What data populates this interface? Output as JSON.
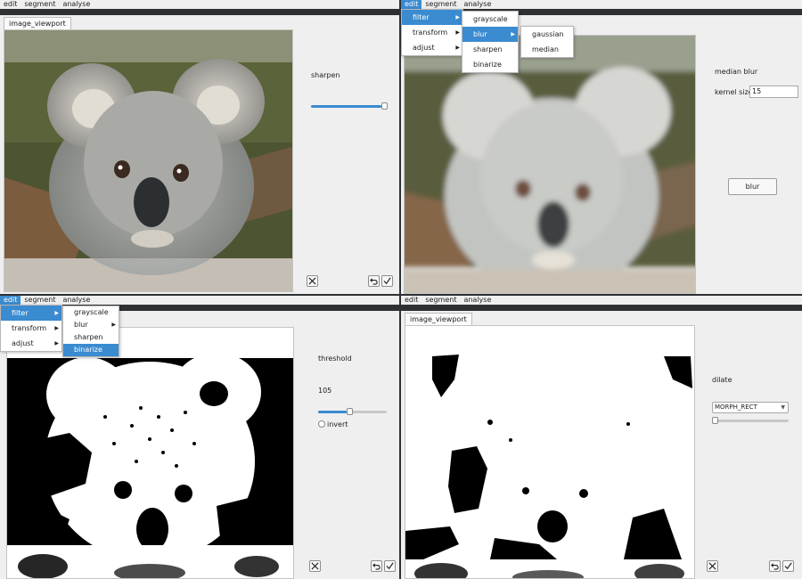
{
  "menu": [
    "edit",
    "segment",
    "analyse"
  ],
  "edit_items": [
    "filter",
    "transform",
    "adjust"
  ],
  "filter_items": [
    "grayscale",
    "blur",
    "sharpen",
    "binarize"
  ],
  "blur_items": [
    "gaussian",
    "median"
  ],
  "viewport_tab": "image_viewport",
  "panel1": {
    "title": "sharpen",
    "slider_value": 0.98
  },
  "panel2": {
    "title": "median blur",
    "kernel_label": "kernel size",
    "kernel_value": "15",
    "button": "blur"
  },
  "panel3": {
    "title": "threshold",
    "value": "105",
    "slider_value": 0.41,
    "invert_label": "invert"
  },
  "panel4": {
    "title": "dilate",
    "select_value": "MORPH_RECT",
    "slider_value": 0.0
  },
  "icons": {
    "close": "close-icon",
    "undo": "undo-icon",
    "apply": "check-icon"
  },
  "colors": {
    "accent": "#3a8bd0",
    "panel_bg": "#efefef",
    "dark": "#2e3134"
  }
}
